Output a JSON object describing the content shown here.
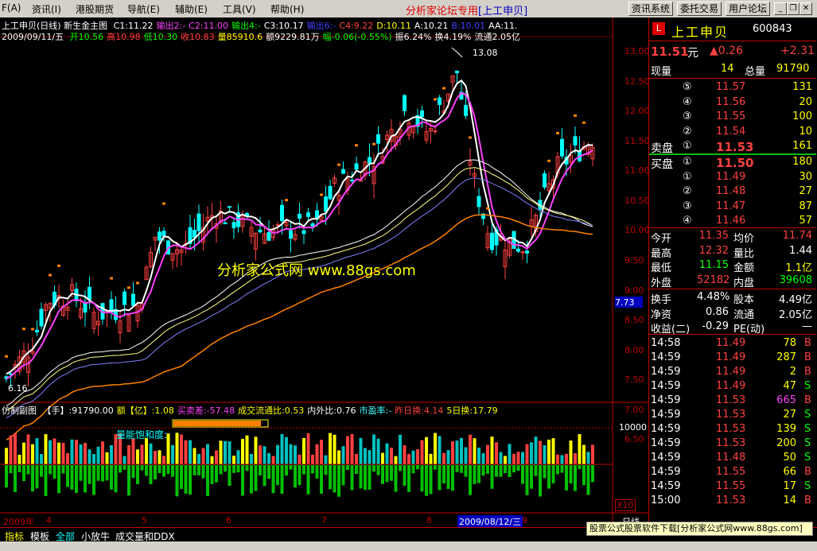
{
  "menu": {
    "items": [
      "F(A)",
      "资讯(I)",
      "港股期货",
      "导航(E)",
      "辅助(E)",
      "工具(V)",
      "帮助(H)"
    ],
    "center_title": "分析家论坛专用",
    "center_stock": "[上工申贝]",
    "buttons": [
      "资讯系统",
      "委托交易",
      "用户论坛"
    ]
  },
  "main_chart": {
    "header_title": "上工申贝(日线)",
    "indicator_name": "新生金主图",
    "params": [
      {
        "text": "C1:11.22",
        "color": "#ffffff"
      },
      {
        "text": "输出2:-",
        "color": "#ff40ff"
      },
      {
        "text": "C2:11.00",
        "color": "#ff40ff"
      },
      {
        "text": "输出4:-",
        "color": "#00ff00"
      },
      {
        "text": "C3:10.17",
        "color": "#ffffff"
      },
      {
        "text": "输出6:-",
        "color": "#4040ff"
      },
      {
        "text": "C4:9.22",
        "color": "#ff4040"
      },
      {
        "text": "D:10.11",
        "color": "#ffff00"
      },
      {
        "text": "A:10.21",
        "color": "#ffffff"
      },
      {
        "text": "B:10.01",
        "color": "#4040ff"
      },
      {
        "text": "AA:11.",
        "color": "#ffffff"
      }
    ],
    "info_date": "2009/09/11/五",
    "info_items": [
      {
        "text": "开10.56",
        "color": "#00ff00"
      },
      {
        "text": "高10.98",
        "color": "#ff4040"
      },
      {
        "text": "低10.30",
        "color": "#00ff00"
      },
      {
        "text": "收10.83",
        "color": "#ff4040"
      },
      {
        "text": "量85910.6",
        "color": "#ffff00"
      },
      {
        "text": "额9229.81万",
        "color": "#ffffff"
      },
      {
        "text": "幅-0.06(-0.55%)",
        "color": "#00ff00"
      },
      {
        "text": "振6.24%",
        "color": "#ffffff"
      },
      {
        "text": "换4.19%",
        "color": "#ffffff"
      },
      {
        "text": "流通2.05亿",
        "color": "#ffffff"
      }
    ],
    "peak_label": "13.08",
    "low_label": "6.16",
    "current_price_tag": "7.73",
    "watermark": "分析家公式网 www.88gs.com",
    "price_axis_labels": [
      "13.00",
      "12.50",
      "12.00",
      "11.50",
      "11.00",
      "10.50",
      "10.00",
      "9.50",
      "9.00",
      "8.50",
      "8.00",
      "7.50",
      "7.00",
      "6.50"
    ]
  },
  "sub_chart": {
    "name": "仿制副图",
    "items": [
      {
        "text": "【手】:91790.00",
        "color": "#ffffff"
      },
      {
        "text": "额【亿】:1.08",
        "color": "#ffff00"
      },
      {
        "text": "买卖差:-57.48",
        "color": "#ff40ff"
      },
      {
        "text": "成交流通比:0.53",
        "color": "#ffff00"
      },
      {
        "text": "内外比:0.76",
        "color": "#ffffff"
      },
      {
        "text": "市盈率:-",
        "color": "#40ffff"
      },
      {
        "text": "昨日换:4.14",
        "color": "#ff4040"
      },
      {
        "text": "5日换:17.79",
        "color": "#ffff00"
      }
    ],
    "saturation_label": "量能饱和度:",
    "axis_label": "10000",
    "axis_unit": "X10"
  },
  "time_axis": {
    "labels": [
      "2009年",
      "4",
      "5",
      "6",
      "7",
      "8",
      "9"
    ],
    "cursor_date": "2009/08/12/三",
    "period": "日线"
  },
  "quote": {
    "name": "上工申贝",
    "code": "600843",
    "last": "11.51",
    "unit": "元",
    "change": "▲0.26",
    "change_pct": "+2.31",
    "volume_label": "现量",
    "volume_lots": "14",
    "volume_total_label": "总量",
    "volume_total": "91790",
    "sell": [
      {
        "level": "⑤",
        "price": "11.57",
        "vol": "131"
      },
      {
        "level": "④",
        "price": "11.56",
        "vol": "20"
      },
      {
        "level": "③",
        "price": "11.55",
        "vol": "100"
      },
      {
        "level": "②",
        "price": "11.54",
        "vol": "10"
      },
      {
        "level": "①",
        "price": "11.53",
        "vol": "161"
      }
    ],
    "sell_label": "卖盘",
    "buy_label": "买盘",
    "buy": [
      {
        "level": "①",
        "price": "11.50",
        "vol": "180"
      },
      {
        "level": "①",
        "price": "11.49",
        "vol": "30"
      },
      {
        "level": "②",
        "price": "11.48",
        "vol": "27"
      },
      {
        "level": "③",
        "price": "11.47",
        "vol": "87"
      },
      {
        "level": "④",
        "price": "11.46",
        "vol": "57"
      }
    ],
    "stats": [
      {
        "l1": "今开",
        "v1": "11.35",
        "c1": "#ff4040",
        "l2": "均价",
        "v2": "11.74",
        "c2": "#ff4040"
      },
      {
        "l1": "最高",
        "v1": "12.32",
        "c1": "#ff4040",
        "l2": "量比",
        "v2": "1.44",
        "c2": "#ffffff"
      },
      {
        "l1": "最低",
        "v1": "11.15",
        "c1": "#00ff00",
        "l2": "金额",
        "v2": "1.1亿",
        "c2": "#ffff00"
      },
      {
        "l1": "外盘",
        "v1": "52182",
        "c1": "#ff4040",
        "l2": "内盘",
        "v2": "39608",
        "c2": "#00ff00"
      }
    ],
    "stats2": [
      {
        "l1": "换手",
        "v1": "4.48%",
        "l2": "股本",
        "v2": "4.49亿"
      },
      {
        "l1": "净资",
        "v1": "0.86",
        "l2": "流通",
        "v2": "2.05亿"
      },
      {
        "l1": "收益(二)",
        "v1": "-0.29",
        "l2": "PE(动)",
        "v2": "—"
      }
    ],
    "ticks": [
      {
        "time": "14:58",
        "price": "11.49",
        "vol": "78",
        "side": "B",
        "vc": "#ffff00"
      },
      {
        "time": "14:59",
        "price": "11.49",
        "vol": "287",
        "side": "B",
        "vc": "#ffff00"
      },
      {
        "time": "14:59",
        "price": "11.49",
        "vol": "2",
        "side": "B",
        "vc": "#ffff00"
      },
      {
        "time": "14:59",
        "price": "11.49",
        "vol": "47",
        "side": "S",
        "vc": "#ffff00"
      },
      {
        "time": "14:59",
        "price": "11.53",
        "vol": "665",
        "side": "B",
        "vc": "#ff40ff"
      },
      {
        "time": "14:59",
        "price": "11.53",
        "vol": "27",
        "side": "S",
        "vc": "#ffff00"
      },
      {
        "time": "14:59",
        "price": "11.53",
        "vol": "139",
        "side": "S",
        "vc": "#ffff00"
      },
      {
        "time": "14:59",
        "price": "11.53",
        "vol": "200",
        "side": "S",
        "vc": "#ffff00"
      },
      {
        "time": "14:59",
        "price": "11.48",
        "vol": "50",
        "side": "S",
        "vc": "#ffff00"
      },
      {
        "time": "14:59",
        "price": "11.55",
        "vol": "66",
        "side": "B",
        "vc": "#ffff00"
      },
      {
        "time": "14:59",
        "price": "11.55",
        "vol": "17",
        "side": "S",
        "vc": "#ffff00"
      },
      {
        "time": "15:00",
        "price": "11.53",
        "vol": "14",
        "side": "B",
        "vc": "#ffff00"
      }
    ]
  },
  "bottom_tabs": [
    "指标",
    "模板",
    "全部",
    "小放牛",
    "成交量和DDX"
  ],
  "ticker_text": "股票公式股票软件下载[分析家公式网www.88gs.com]",
  "colors": {
    "up": "#ff4040",
    "down": "#00ffff",
    "frame": "#c00000"
  }
}
